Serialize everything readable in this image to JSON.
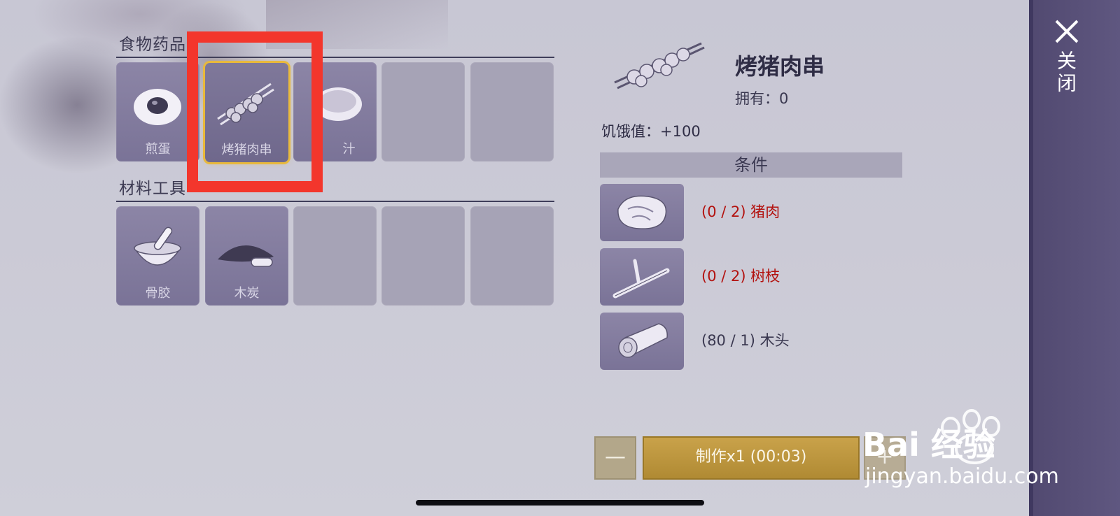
{
  "sections": {
    "food_medicine": {
      "title": "食物药品",
      "slots": [
        {
          "label": "煎蛋",
          "icon": "fried-egg-icon"
        },
        {
          "label": "烤猪肉串",
          "icon": "pork-skewer-icon",
          "selected": true
        },
        {
          "label": "汁",
          "icon": "soup-bowl-icon"
        }
      ]
    },
    "materials_tools": {
      "title": "材料工具",
      "slots": [
        {
          "label": "骨胶",
          "icon": "mortar-pestle-icon"
        },
        {
          "label": "木炭",
          "icon": "charcoal-pile-icon"
        }
      ]
    }
  },
  "detail": {
    "name": "烤猪肉串",
    "owned": "拥有：0",
    "effect": "饥饿值：+100",
    "conditions_header": "条件",
    "requirements": [
      {
        "text": "(0 / 2) 猪肉",
        "icon": "raw-meat-icon",
        "status": "insufficient"
      },
      {
        "text": "(0 / 2) 树枝",
        "icon": "branch-icon",
        "status": "insufficient"
      },
      {
        "text": "(80 / 1) 木头",
        "icon": "log-icon",
        "status": "sufficient"
      }
    ]
  },
  "actions": {
    "minus": "—",
    "make": "制作x1 (00:03)",
    "plus": "+"
  },
  "close": {
    "label": "关闭",
    "icon": "close-icon"
  },
  "watermark": {
    "line1": "Bai 经验",
    "line2": "jingyan.baidu.com"
  },
  "colors": {
    "selected_border": "#e8b93c",
    "insufficient_text": "#b3120f",
    "make_button": "#c9a24a",
    "annotation_box": "#f3362c"
  }
}
